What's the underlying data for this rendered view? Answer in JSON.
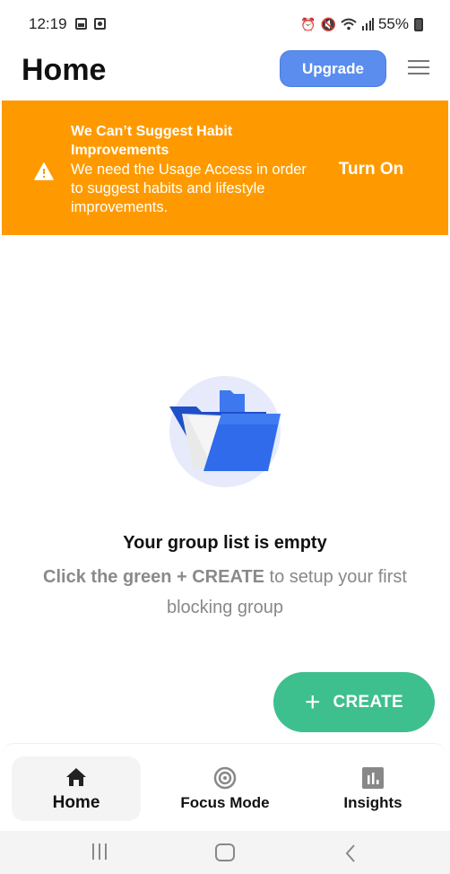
{
  "status_bar": {
    "time": "12:19",
    "left_icons": [
      "gallery-icon",
      "screen-record-icon"
    ],
    "right_icons": [
      "alarm-icon",
      "mute-icon",
      "wifi-icon",
      "signal-icon"
    ],
    "battery": "55%"
  },
  "header": {
    "title": "Home",
    "upgrade_label": "Upgrade",
    "menu_icon": "hamburger-menu-icon"
  },
  "banner": {
    "icon": "warning-icon",
    "title": "We Can’t Suggest Habit Improvements",
    "body": "We need the Usage Access in order to suggest habits and lifestyle improvements.",
    "action_label": "Turn On",
    "color": "#fe9a00"
  },
  "empty_state": {
    "illustration": "open-folder-icon",
    "title": "Your group list is empty",
    "hint_bold": "Click the green + CREATE",
    "hint_rest": " to setup your first blocking group"
  },
  "fab": {
    "icon": "plus-icon",
    "label": "CREATE",
    "color": "#3ebf8e"
  },
  "bottom_nav": {
    "items": [
      {
        "label": "Home",
        "icon": "home-icon",
        "active": true
      },
      {
        "label": "Focus Mode",
        "icon": "target-icon",
        "active": false
      },
      {
        "label": "Insights",
        "icon": "bar-chart-icon",
        "active": false
      }
    ]
  },
  "system_nav": {
    "buttons": [
      "recent-apps",
      "home",
      "back"
    ]
  }
}
